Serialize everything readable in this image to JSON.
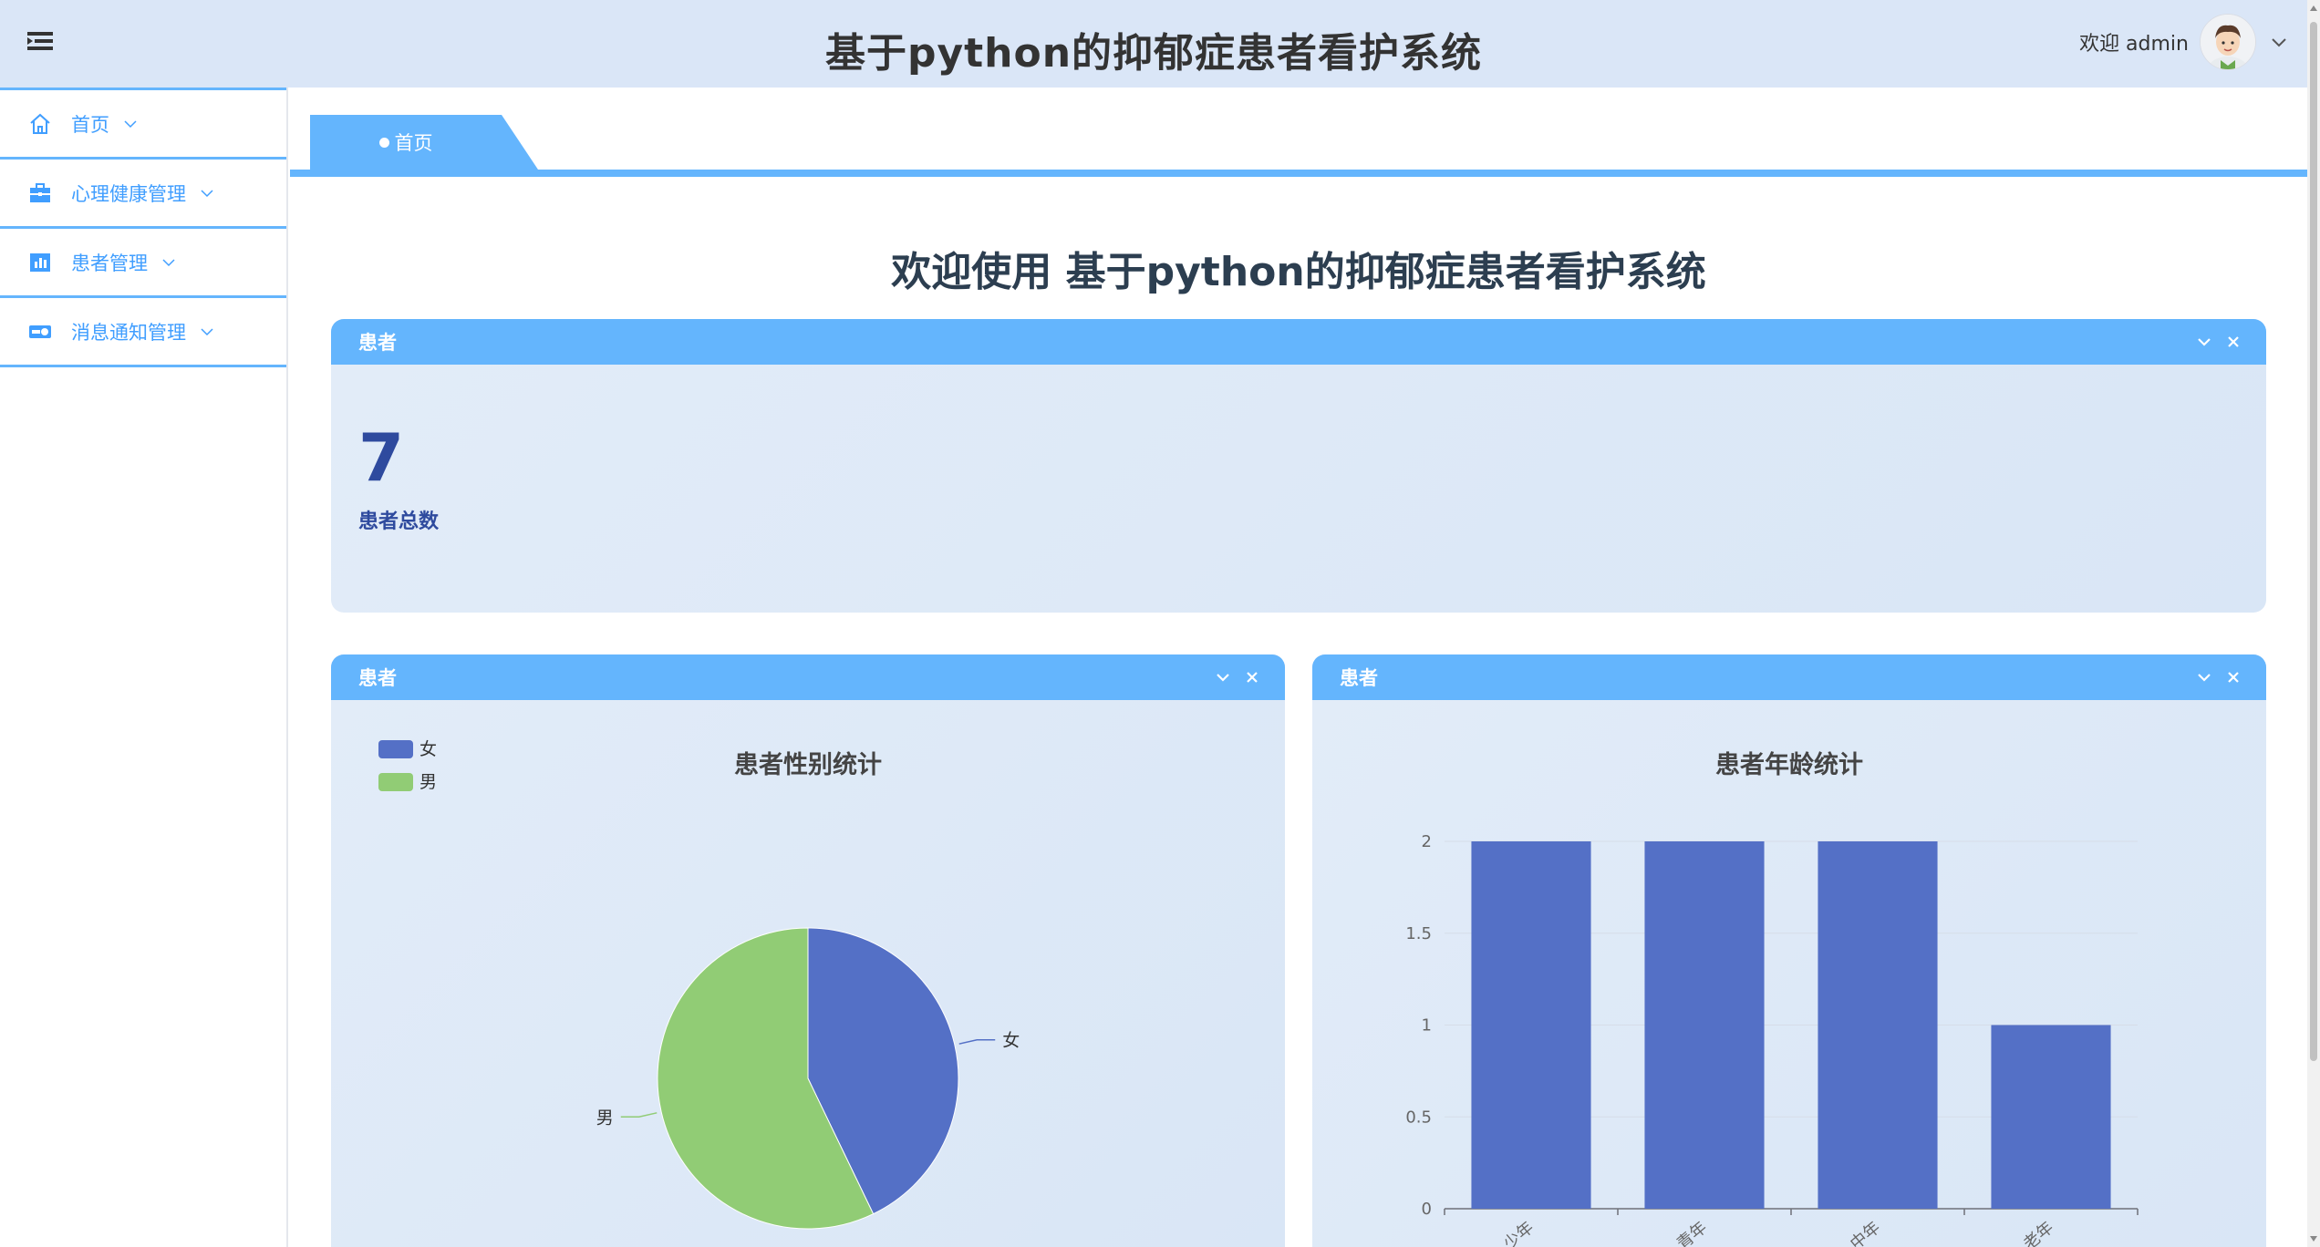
{
  "header": {
    "title": "基于python的抑郁症患者看护系统",
    "welcome": "欢迎 admin"
  },
  "icons": {
    "menu_toggle": "hamburger-icon",
    "user_dropdown": "chevron-down-icon"
  },
  "sidebar": {
    "items": [
      {
        "label": "首页",
        "icon": "home-icon"
      },
      {
        "label": "心理健康管理",
        "icon": "briefcase-icon"
      },
      {
        "label": "患者管理",
        "icon": "bar-chart-icon"
      },
      {
        "label": "消息通知管理",
        "icon": "toggle-icon"
      }
    ]
  },
  "tabs": {
    "active_label": "首页"
  },
  "main": {
    "welcome_heading": "欢迎使用 基于python的抑郁症患者看护系统",
    "stat_card": {
      "header": "患者",
      "value": "7",
      "label": "患者总数"
    },
    "gender_card": {
      "header": "患者"
    },
    "age_card": {
      "header": "患者"
    }
  },
  "colors": {
    "accent": "#64b5fd",
    "series_blue": "#5470c6",
    "series_green": "#91cc75",
    "stat_text": "#2e4a9e"
  },
  "chart_data": [
    {
      "type": "pie",
      "title": "患者性别统计",
      "categories": [
        "女",
        "男"
      ],
      "values": [
        3,
        4
      ],
      "legend": "top-left",
      "colors": [
        "#5470c6",
        "#91cc75"
      ]
    },
    {
      "type": "bar",
      "title": "患者年龄统计",
      "categories": [
        "少年",
        "青年",
        "中年",
        "老年"
      ],
      "values": [
        2,
        2,
        2,
        1
      ],
      "ylim": [
        0,
        2
      ],
      "yticks": [
        "0",
        "0.5",
        "1",
        "1.5",
        "2"
      ],
      "grid": true,
      "color": "#5470c6"
    }
  ]
}
